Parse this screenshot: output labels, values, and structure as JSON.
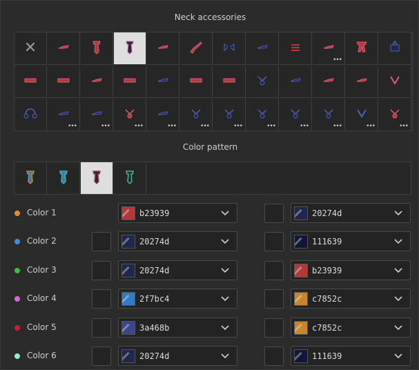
{
  "neck": {
    "title": "Neck accessories",
    "items": [
      {
        "icon": "none-x-icon",
        "kind": "none",
        "dots": false
      },
      {
        "icon": "neck-item-icon",
        "color": "#b23939",
        "shape": "small",
        "dots": false
      },
      {
        "icon": "tie-icon",
        "color": "#b23939",
        "shape": "tie",
        "dots": false
      },
      {
        "icon": "tie-icon",
        "color": "#20274d",
        "shape": "tie",
        "dots": false,
        "selected": true
      },
      {
        "icon": "neck-item-icon",
        "color": "#b23939",
        "shape": "small",
        "dots": false
      },
      {
        "icon": "guitar-icon",
        "color": "#b23939",
        "shape": "guitar",
        "dots": false
      },
      {
        "icon": "bow-icon",
        "color": "#20274d",
        "shape": "bow",
        "dots": false
      },
      {
        "icon": "neck-item-icon",
        "color": "#20274d",
        "shape": "small",
        "dots": false
      },
      {
        "icon": "stripes-icon",
        "color": "#b23939",
        "shape": "stripes",
        "dots": false
      },
      {
        "icon": "neck-item-icon",
        "color": "#b23939",
        "shape": "small",
        "dots": true
      },
      {
        "icon": "scarf-icon",
        "color": "#b23939",
        "shape": "scarf",
        "dots": false
      },
      {
        "icon": "bag-icon",
        "color": "#20274d",
        "shape": "bag",
        "dots": false
      },
      {
        "icon": "neck-item-icon",
        "color": "#b23939",
        "shape": "band",
        "dots": false
      },
      {
        "icon": "bow-icon",
        "color": "#b23939",
        "shape": "band",
        "dots": false
      },
      {
        "icon": "neck-item-icon",
        "color": "#b23939",
        "shape": "small",
        "dots": false
      },
      {
        "icon": "neck-item-icon",
        "color": "#b23939",
        "shape": "band",
        "dots": false
      },
      {
        "icon": "neck-item-icon",
        "color": "#20274d",
        "shape": "small",
        "dots": false
      },
      {
        "icon": "neck-item-icon",
        "color": "#b23939",
        "shape": "band",
        "dots": false
      },
      {
        "icon": "neck-item-icon",
        "color": "#b23939",
        "shape": "band",
        "dots": false
      },
      {
        "icon": "pendant-icon",
        "color": "#20274d",
        "shape": "pendant",
        "dots": false
      },
      {
        "icon": "pendant-icon",
        "color": "#20274d",
        "shape": "small",
        "dots": false
      },
      {
        "icon": "neck-item-icon",
        "color": "#b23939",
        "shape": "small",
        "dots": false
      },
      {
        "icon": "neck-item-icon",
        "color": "#b23939",
        "shape": "small",
        "dots": false
      },
      {
        "icon": "necklace-icon",
        "color": "#b23939",
        "shape": "vneck",
        "dots": false
      },
      {
        "icon": "headphones-icon",
        "color": "#20274d",
        "shape": "headphones",
        "dots": false
      },
      {
        "icon": "pendant-icon",
        "color": "#20274d",
        "shape": "small",
        "dots": true
      },
      {
        "icon": "pendant-icon",
        "color": "#20274d",
        "shape": "small",
        "dots": true
      },
      {
        "icon": "pendant-icon",
        "color": "#b23939",
        "shape": "pendant",
        "dots": true
      },
      {
        "icon": "pendant-icon",
        "color": "#20274d",
        "shape": "small",
        "dots": true
      },
      {
        "icon": "pendant-icon",
        "color": "#20274d",
        "shape": "pendant",
        "dots": true
      },
      {
        "icon": "pendant-icon",
        "color": "#20274d",
        "shape": "pendant",
        "dots": true
      },
      {
        "icon": "pendant-icon",
        "color": "#20274d",
        "shape": "pendant",
        "dots": true
      },
      {
        "icon": "pendant-icon",
        "color": "#20274d",
        "shape": "pendant",
        "dots": true
      },
      {
        "icon": "pendant-icon",
        "color": "#20274d",
        "shape": "pendant",
        "dots": true
      },
      {
        "icon": "pendant-icon",
        "color": "#20274d",
        "shape": "vneck",
        "dots": true
      },
      {
        "icon": "pendant-icon",
        "color": "#b23939",
        "shape": "pendant",
        "dots": true
      }
    ]
  },
  "pattern": {
    "title": "Color pattern",
    "items": [
      {
        "icon": "tie-pattern-icon",
        "color": "#2f7bc4",
        "accent": "#c7852c",
        "selected": false
      },
      {
        "icon": "tie-pattern-icon",
        "color": "#2f7bc4",
        "accent": "#3fbf7f",
        "selected": false
      },
      {
        "icon": "tie-pattern-icon",
        "color": "#20274d",
        "accent": "#b23939",
        "selected": true
      },
      {
        "icon": "tie-pattern-icon",
        "color": "#20274d",
        "accent": "#3fbf7f",
        "selected": false
      }
    ]
  },
  "colors": [
    {
      "label": "Color 1",
      "dot": "#e0902c",
      "left_check": false,
      "left_value": "b23939",
      "left_swatch": "#b23939",
      "right_value": "20274d",
      "right_swatch": "#20274d"
    },
    {
      "label": "Color 2",
      "dot": "#3f8be0",
      "left_check": true,
      "left_value": "20274d",
      "left_swatch": "#20274d",
      "right_value": "111639",
      "right_swatch": "#111639"
    },
    {
      "label": "Color 3",
      "dot": "#33c23a",
      "left_check": true,
      "left_value": "20274d",
      "left_swatch": "#20274d",
      "right_value": "b23939",
      "right_swatch": "#b23939"
    },
    {
      "label": "Color 4",
      "dot": "#d06bd8",
      "left_check": true,
      "left_value": "2f7bc4",
      "left_swatch": "#2f7bc4",
      "right_value": "c7852c",
      "right_swatch": "#c7852c"
    },
    {
      "label": "Color 5",
      "dot": "#d6143f",
      "left_check": true,
      "left_value": "3a468b",
      "left_swatch": "#3a468b",
      "right_value": "c7852c",
      "right_swatch": "#c7852c"
    },
    {
      "label": "Color 6",
      "dot": "#8ef0c8",
      "left_check": true,
      "left_value": "20274d",
      "left_swatch": "#20274d",
      "right_value": "111639",
      "right_swatch": "#111639"
    }
  ]
}
